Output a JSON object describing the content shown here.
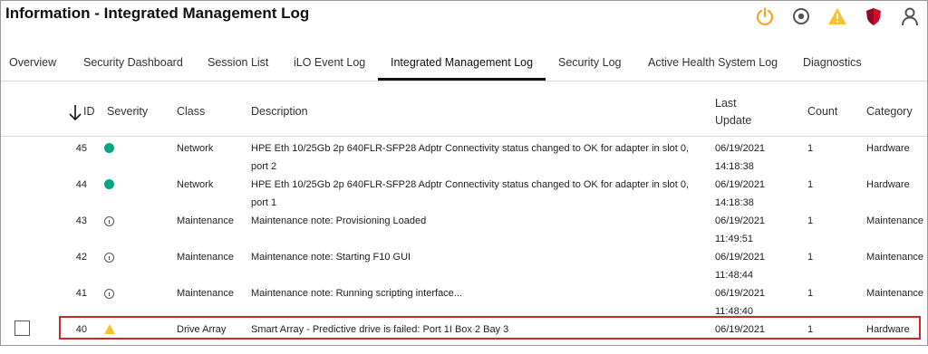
{
  "page_title": "Information - Integrated Management Log",
  "header_icons": [
    "power-icon",
    "locate-icon",
    "warning-icon",
    "security-shield-icon",
    "user-icon"
  ],
  "tabs": [
    {
      "label": "Overview"
    },
    {
      "label": "Security Dashboard"
    },
    {
      "label": "Session List"
    },
    {
      "label": "iLO Event Log"
    },
    {
      "label": "Integrated Management Log",
      "active": true
    },
    {
      "label": "Security Log"
    },
    {
      "label": "Active Health System Log"
    },
    {
      "label": "Diagnostics"
    }
  ],
  "table": {
    "sort_icon": "arrow-down-icon",
    "columns": {
      "id": "ID",
      "severity": "Severity",
      "class": "Class",
      "description": "Description",
      "last_update_1": "Last",
      "last_update_2": "Update",
      "count": "Count",
      "category": "Category"
    },
    "rows": [
      {
        "id": "45",
        "severity": "ok",
        "class": "Network",
        "desc1": "HPE Eth 10/25Gb 2p 640FLR-SFP28 Adptr Connectivity status changed to OK for adapter in slot 0,",
        "desc2": "port 2",
        "date": "06/19/2021",
        "time": "14:18:38",
        "count": "1",
        "category": "Hardware"
      },
      {
        "id": "44",
        "severity": "ok",
        "class": "Network",
        "desc1": "HPE Eth 10/25Gb 2p 640FLR-SFP28 Adptr Connectivity status changed to OK for adapter in slot 0,",
        "desc2": "port 1",
        "date": "06/19/2021",
        "time": "14:18:38",
        "count": "1",
        "category": "Hardware"
      },
      {
        "id": "43",
        "severity": "info",
        "class": "Maintenance",
        "desc1": "Maintenance note: Provisioning Loaded",
        "desc2": "",
        "date": "06/19/2021",
        "time": "11:49:51",
        "count": "1",
        "category": "Maintenance"
      },
      {
        "id": "42",
        "severity": "info",
        "class": "Maintenance",
        "desc1": "Maintenance note: Starting F10 GUI",
        "desc2": "",
        "date": "06/19/2021",
        "time": "11:48:44",
        "count": "1",
        "category": "Maintenance"
      },
      {
        "id": "41",
        "severity": "info",
        "class": "Maintenance",
        "desc1": "Maintenance note: Running scripting interface...",
        "desc2": "",
        "date": "06/19/2021",
        "time": "11:48:40",
        "count": "1",
        "category": "Maintenance"
      },
      {
        "id": "40",
        "severity": "warning",
        "class": "Drive Array",
        "desc1": "Smart Array - Predictive drive is failed: Port 1I Box 2 Bay 3",
        "desc2": "",
        "date": "06/19/2021",
        "time": "",
        "count": "1",
        "category": "Hardware",
        "selected_highlight": true
      }
    ]
  },
  "colors": {
    "ok": "#01a982",
    "warning": "#f7c12f",
    "critical": "#c8102e",
    "highlight_border": "#cc2a2a",
    "power": "#f5a623"
  }
}
